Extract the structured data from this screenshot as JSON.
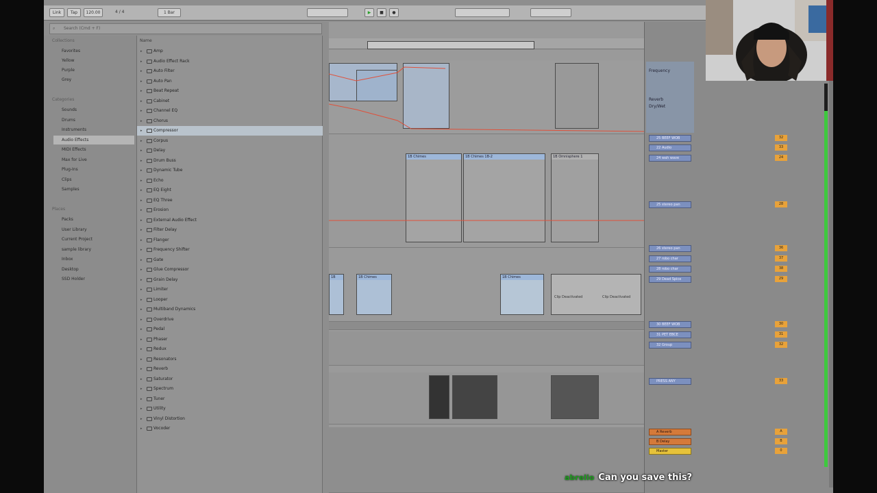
{
  "transport": {
    "link": "Link",
    "tap": "Tap",
    "tempo": "120.00",
    "signature": "4 / 4",
    "quant": "1 Bar"
  },
  "browser": {
    "search_placeholder": "Search (Cmd + F)",
    "collections_head": "Collections",
    "categories_head": "Categories",
    "places_head": "Places",
    "collections": [
      {
        "label": "Favorites",
        "color": "#e05a3a"
      },
      {
        "label": "Yellow",
        "color": "#e6c23a"
      },
      {
        "label": "Purple",
        "color": "#9a6ad8"
      },
      {
        "label": "Grey",
        "color": "#8a8a8a"
      }
    ],
    "categories": [
      "Sounds",
      "Drums",
      "Instruments",
      "Audio Effects",
      "MIDI Effects",
      "Max for Live",
      "Plug-Ins",
      "Clips",
      "Samples"
    ],
    "places": [
      "Packs",
      "User Library",
      "Current Project",
      "sample library",
      "Inbox",
      "Desktop",
      "SSD Holder"
    ],
    "list_header": "Name",
    "devices": [
      "Amp",
      "Audio Effect Rack",
      "Auto Filter",
      "Auto Pan",
      "Beat Repeat",
      "Cabinet",
      "Channel EQ",
      "Chorus",
      "Compressor",
      "Corpus",
      "Delay",
      "Drum Buss",
      "Dynamic Tube",
      "Echo",
      "EQ Eight",
      "EQ Three",
      "Erosion",
      "External Audio Effect",
      "Filter Delay",
      "Flanger",
      "Frequency Shifter",
      "Gate",
      "Glue Compressor",
      "Grain Delay",
      "Limiter",
      "Looper",
      "Multiband Dynamics",
      "Overdrive",
      "Pedal",
      "Phaser",
      "Redux",
      "Resonators",
      "Reverb",
      "Saturator",
      "Spectrum",
      "Tuner",
      "Utility",
      "Vinyl Distortion",
      "Vocoder"
    ]
  },
  "mixer": {
    "device_title": "Frequency",
    "device_params": [
      "Reverb",
      "Dry/Wet"
    ],
    "tracks": [
      {
        "name": "25 BEEF WOB",
        "vol": "32"
      },
      {
        "name": "22 Audio",
        "vol": "33"
      },
      {
        "name": "24 wah wave",
        "vol": "24"
      },
      {
        "name": "25 stereo pan",
        "vol": "28"
      },
      {
        "name": "26 stereo pan",
        "vol": "36"
      },
      {
        "name": "27 robo char",
        "vol": "37"
      },
      {
        "name": "28 robo char",
        "vol": "38"
      },
      {
        "name": "29 Dead Spice",
        "vol": "29"
      },
      {
        "name": "30 BEEF WOB",
        "vol": "30"
      },
      {
        "name": "31 PET EBCE",
        "vol": "31"
      },
      {
        "name": "32 Group",
        "vol": "32"
      },
      {
        "name": "PRESS ANY",
        "vol": "33"
      }
    ],
    "returns": [
      {
        "name": "A Reverb",
        "vol": "A"
      },
      {
        "name": "B Delay",
        "vol": "B"
      },
      {
        "name": "Master",
        "vol": "0"
      }
    ]
  },
  "clips": {
    "deactivated": "Clip Deactivated",
    "clip_a": "1B Chimes",
    "clip_b": "1B Chimes 1B-2",
    "clip_c": "1B Omnisphere 1"
  },
  "chat": {
    "user": "abrelio",
    "message": "Can you save this?"
  }
}
